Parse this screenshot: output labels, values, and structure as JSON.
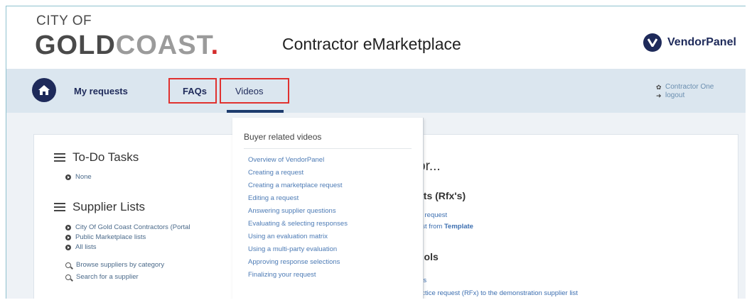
{
  "header": {
    "logo_top": "CITY OF",
    "logo_gold": "GOLD",
    "logo_coast": "COAST",
    "logo_dot": ".",
    "app_title": "Contractor eMarketplace",
    "brand": "VendorPanel"
  },
  "nav": {
    "items": [
      {
        "label": "My requests"
      },
      {
        "label": "FAQs"
      },
      {
        "label": "Videos"
      }
    ],
    "user": {
      "name": "Contractor One",
      "logout": "logout"
    }
  },
  "todo": {
    "title": "To-Do Tasks",
    "items": [
      "None"
    ]
  },
  "supplier_lists": {
    "title": "Supplier Lists",
    "items": [
      "City Of Gold Coast Contractors (Portal",
      "Public Marketplace lists",
      "All lists"
    ],
    "search_links": [
      "Browse suppliers by category",
      "Search for a supplier"
    ]
  },
  "right_panel": {
    "heading_partial": "or...",
    "requests_heading": "sts (Rfx's)",
    "link_new": "w request",
    "link_template_prefix": "est from ",
    "link_template_bold": "Template",
    "tools_heading": "ools",
    "link_als": "als",
    "practice_text": "actice request (RFx) to the demonstration supplier list"
  },
  "dropdown": {
    "header": "Buyer related videos",
    "items": [
      "Overview of VendorPanel",
      "Creating a request",
      "Creating a marketplace request",
      "Editing a request",
      "Answering supplier questions",
      "Evaluating & selecting responses",
      "Using an evaluation matrix",
      "Using a multi-party evaluation",
      "Approving response selections",
      "Finalizing your request"
    ]
  },
  "colors": {
    "navy": "#1e2a5a",
    "nav_bg": "#dbe6ef",
    "highlight_box": "#e0312f",
    "link": "#4d7bb5",
    "logo_red": "#d42b2b"
  },
  "icons": [
    "home-icon",
    "vendorpanel-logo-icon",
    "gear-icon",
    "logout-icon",
    "list-icon",
    "arrow-circle-icon",
    "search-icon"
  ]
}
